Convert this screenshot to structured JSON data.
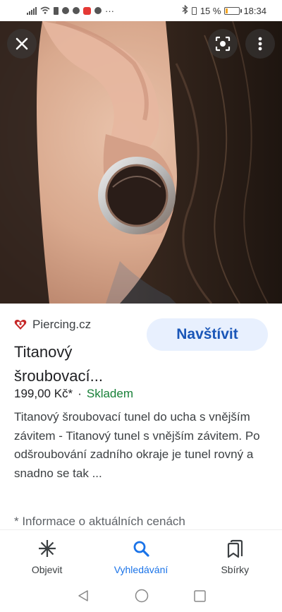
{
  "status_bar": {
    "battery_percent_text": "15 %",
    "battery_level": 0.15,
    "time": "18:34",
    "more_icons": "···"
  },
  "hero": {
    "close_icon": "close-icon",
    "lens_icon": "lens-icon",
    "more_icon": "more-vert-icon"
  },
  "result": {
    "source": "Piercing.cz",
    "visit_label": "Navštívit",
    "title_line1": "Titanový",
    "title_line2": "šroubovací...",
    "price": "199,00 Kč*",
    "separator": "·",
    "availability": "Skladem",
    "description": "Titanový šroubovací tunel do ucha s vnějším závitem - Titanový tunel s vnějším závitem. Po odšroubování zadního okraje je tunel rovný a snadno se tak ...",
    "footnote": "* Informace o aktuálních cenách"
  },
  "bottom_nav": {
    "items": [
      {
        "label": "Objevit",
        "icon": "asterisk-icon"
      },
      {
        "label": "Vyhledávání",
        "icon": "search-icon"
      },
      {
        "label": "Sbírky",
        "icon": "collections-icon"
      }
    ]
  },
  "colors": {
    "accent": "#1a73e8",
    "visit_bg": "#e8f0fe",
    "stock_green": "#188038",
    "brand_red": "#c62828"
  }
}
